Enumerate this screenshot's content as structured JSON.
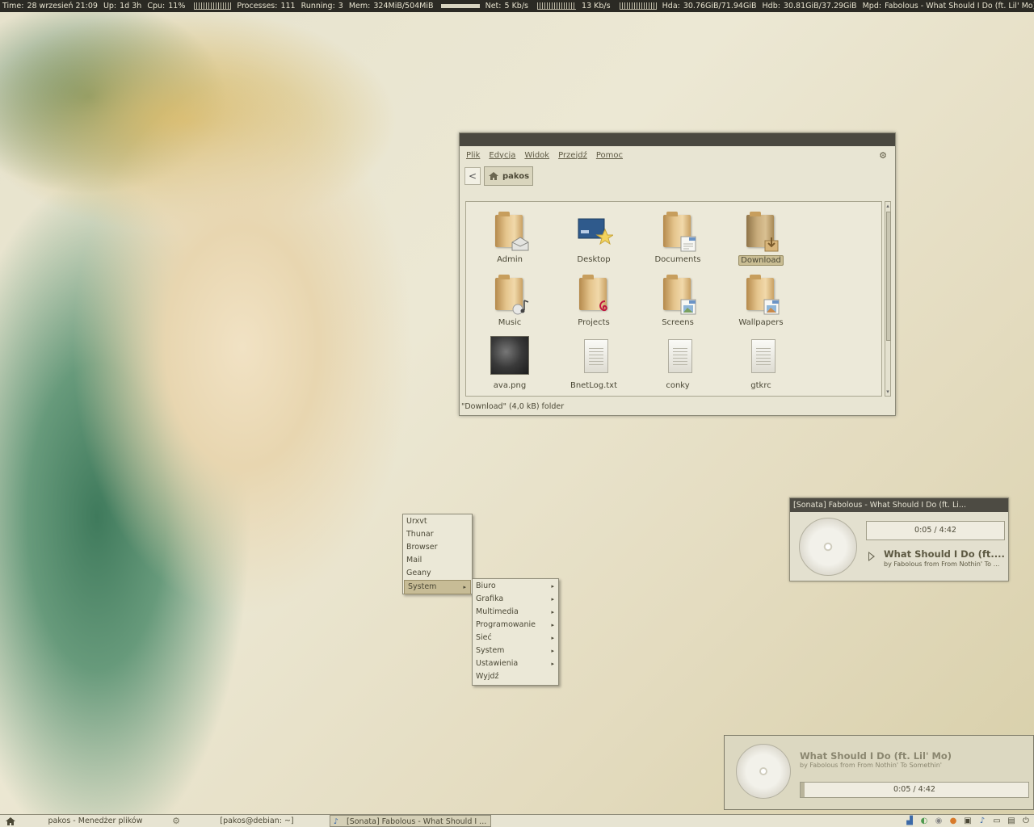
{
  "conky": {
    "time_label": "Time:",
    "time": "28 wrzesień 21:09",
    "up_label": "Up:",
    "up": "1d 3h",
    "cpu_label": "Cpu:",
    "cpu": "11%",
    "processes_label": "Processes:",
    "processes": "111",
    "running_label": "Running:",
    "running": "3",
    "mem_label": "Mem:",
    "mem": "324MiB/504MiB",
    "net_label": "Net:",
    "net_down": "5 Kb/s",
    "net_up": "13 Kb/s",
    "hda_label": "Hda:",
    "hda": "30.76GiB/71.94GiB",
    "hdb_label": "Hdb:",
    "hdb": "30.81GiB/37.29GiB",
    "mpd_label": "Mpd:",
    "mpd": "Fabolous - What Should I Do (ft. Lil' Mo)"
  },
  "file_manager": {
    "menu": [
      "Plik",
      "Edycja",
      "Widok",
      "Przejdź",
      "Pomoc"
    ],
    "back_symbol": "<",
    "location": "pakos",
    "items": [
      {
        "label": "Admin",
        "icon": "folder-mail-icon"
      },
      {
        "label": "Desktop",
        "icon": "desktop-folder-icon"
      },
      {
        "label": "Documents",
        "icon": "folder-documents-icon"
      },
      {
        "label": "Download",
        "icon": "folder-download-icon",
        "selected": true
      },
      {
        "label": "Music",
        "icon": "folder-music-icon"
      },
      {
        "label": "Projects",
        "icon": "folder-debian-icon"
      },
      {
        "label": "Screens",
        "icon": "folder-images-icon"
      },
      {
        "label": "Wallpapers",
        "icon": "folder-images-icon"
      },
      {
        "label": "ava.png",
        "icon": "image-thumbnail-icon"
      },
      {
        "label": "BnetLog.txt",
        "icon": "text-file-icon"
      },
      {
        "label": "conky",
        "icon": "text-file-icon"
      },
      {
        "label": "gtkrc",
        "icon": "text-file-icon"
      }
    ],
    "status": "\"Download\" (4,0 kB) folder"
  },
  "root_menu": {
    "items": [
      "Urxvt",
      "Thunar",
      "Browser",
      "Mail",
      "Geany",
      "System"
    ],
    "selected": "System"
  },
  "system_submenu": {
    "items": [
      "Biuro",
      "Grafika",
      "Multimedia",
      "Programowanie",
      "Sieć",
      "System",
      "Ustawienia",
      "Wyjdź"
    ],
    "arrow": "▸"
  },
  "sonata": {
    "title": "[Sonata] Fabolous - What Should I Do (ft. Li...",
    "time": "0:05 / 4:42",
    "progress_fraction": 0.018,
    "song": "What Should I Do (ft....",
    "by": "by Fabolous from From Nothin' To ..."
  },
  "notification": {
    "song": "What Should I Do (ft. Lil' Mo)",
    "by": "by Fabolous from From Nothin' To Somethin'",
    "time": "0:05 / 4:42",
    "progress_fraction": 0.018
  },
  "taskbar": {
    "items": [
      {
        "label": "pakos - Menedżer plików"
      },
      {
        "label": "[pakos@debian: ~]"
      },
      {
        "label": "[Sonata] Fabolous - What Should I ..."
      }
    ]
  }
}
